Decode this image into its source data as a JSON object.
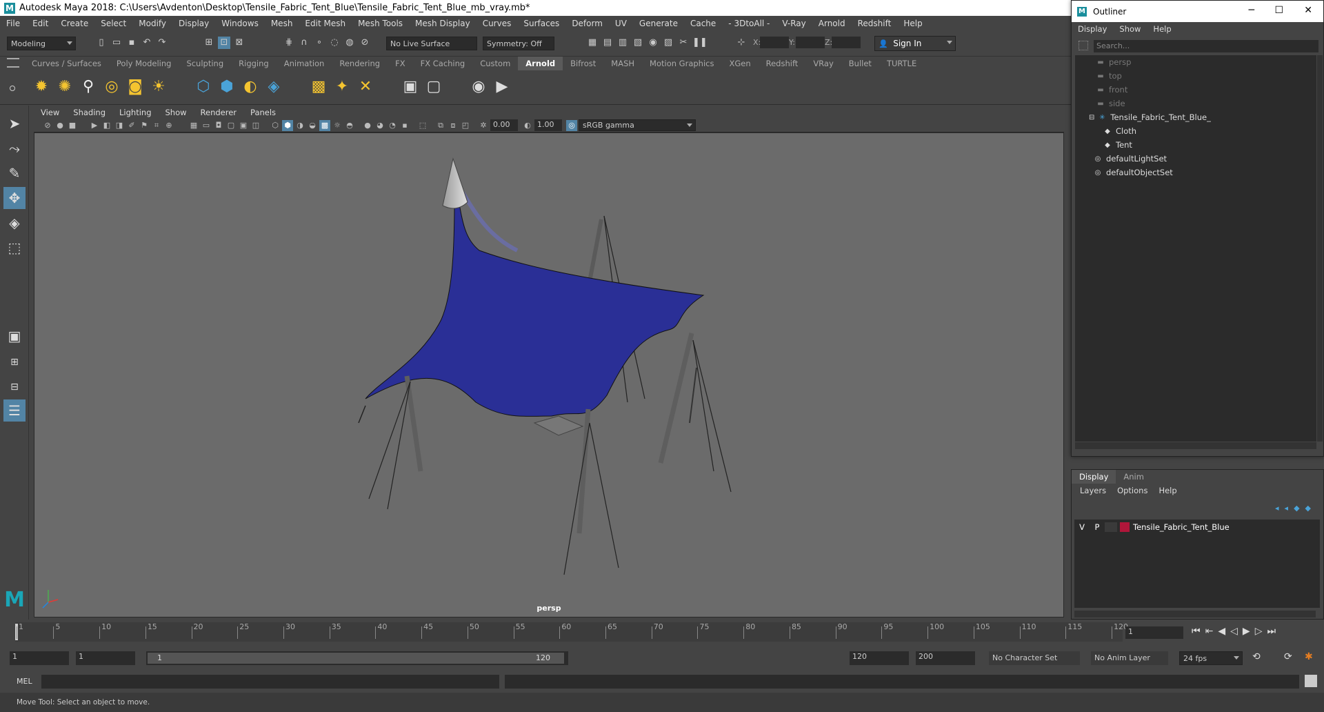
{
  "window": {
    "title": "Autodesk Maya 2018: C:\\Users\\Avdenton\\Desktop\\Tensile_Fabric_Tent_Blue\\Tensile_Fabric_Tent_Blue_mb_vray.mb*"
  },
  "menubar": [
    "File",
    "Edit",
    "Create",
    "Select",
    "Modify",
    "Display",
    "Windows",
    "Mesh",
    "Edit Mesh",
    "Mesh Tools",
    "Mesh Display",
    "Curves",
    "Surfaces",
    "Deform",
    "UV",
    "Generate",
    "Cache",
    "- 3DtoAll -",
    "V-Ray",
    "Arnold",
    "Redshift",
    "Help"
  ],
  "statusline": {
    "mode": "Modeling",
    "live_surface": "No Live Surface",
    "symmetry": "Symmetry: Off",
    "x_label": "X:",
    "y_label": "Y:",
    "z_label": "Z:",
    "sign_in": "Sign In"
  },
  "shelf_tabs": [
    "Curves / Surfaces",
    "Poly Modeling",
    "Sculpting",
    "Rigging",
    "Animation",
    "Rendering",
    "FX",
    "FX Caching",
    "Custom",
    "Arnold",
    "Bifrost",
    "MASH",
    "Motion Graphics",
    "XGen",
    "Redshift",
    "VRay",
    "Bullet",
    "TURTLE"
  ],
  "active_shelf_tab": "Arnold",
  "viewport": {
    "menu": [
      "View",
      "Shading",
      "Lighting",
      "Show",
      "Renderer",
      "Panels"
    ],
    "exposure": "0.00",
    "gamma": "1.00",
    "colorspace": "sRGB gamma",
    "camera_label": "persp",
    "fabric_color": "#2a2f96"
  },
  "outliner": {
    "title": "Outliner",
    "menu": [
      "Display",
      "Show",
      "Help"
    ],
    "search_placeholder": "Search...",
    "items": [
      {
        "label": "persp",
        "type": "camera",
        "dim": true
      },
      {
        "label": "top",
        "type": "camera",
        "dim": true
      },
      {
        "label": "front",
        "type": "camera",
        "dim": true
      },
      {
        "label": "side",
        "type": "camera",
        "dim": true
      },
      {
        "label": "Tensile_Fabric_Tent_Blue_",
        "type": "group",
        "dim": false
      },
      {
        "label": "Cloth",
        "type": "mesh",
        "dim": false
      },
      {
        "label": "Tent",
        "type": "mesh",
        "dim": false
      },
      {
        "label": "defaultLightSet",
        "type": "set",
        "dim": false
      },
      {
        "label": "defaultObjectSet",
        "type": "set",
        "dim": false
      }
    ]
  },
  "layers": {
    "tabs": [
      "Display",
      "Anim"
    ],
    "menu": [
      "Layers",
      "Options",
      "Help"
    ],
    "row": {
      "v": "V",
      "p": "P",
      "name": "Tensile_Fabric_Tent_Blue",
      "color": "#b0163a"
    }
  },
  "timeline": {
    "ticks": [
      "1",
      "5",
      "10",
      "15",
      "20",
      "25",
      "30",
      "35",
      "40",
      "45",
      "50",
      "55",
      "60",
      "65",
      "70",
      "75",
      "80",
      "85",
      "90",
      "95",
      "100",
      "105",
      "110",
      "115",
      "120"
    ],
    "current_frame": "1"
  },
  "range": {
    "start": "1",
    "inner_start": "1",
    "slider_start": "1",
    "slider_end": "120",
    "end": "120",
    "max_end": "200",
    "character_set": "No Character Set",
    "anim_layer": "No Anim Layer",
    "fps": "24 fps"
  },
  "cmd": {
    "label": "MEL"
  },
  "help_line": "Move Tool: Select an object to move."
}
